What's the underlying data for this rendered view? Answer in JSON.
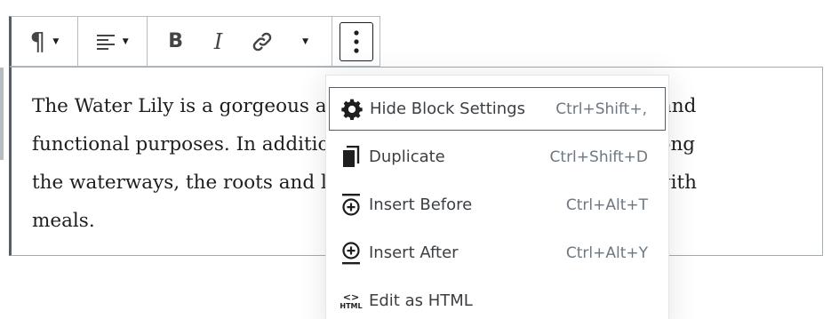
{
  "paragraph": {
    "text": "The Water Lily is a gorgeous and often used flower for aesthetic and\nfunctional purposes.  In addition to the flowers used as blooms along\nthe waterways, the roots and leaves are used in culinary dishes with\nmeals."
  },
  "toolbar": {
    "paragraph_icon": "¶",
    "bold_label": "B",
    "italic_label": "I"
  },
  "menu": {
    "items": [
      {
        "label": "Hide Block Settings",
        "shortcut": "Ctrl+Shift+,",
        "icon": "gear-icon",
        "focused": true
      },
      {
        "label": "Duplicate",
        "shortcut": "Ctrl+Shift+D",
        "icon": "duplicate-icon",
        "focused": false
      },
      {
        "label": "Insert Before",
        "shortcut": "Ctrl+Alt+T",
        "icon": "insert-before-icon",
        "focused": false
      },
      {
        "label": "Insert After",
        "shortcut": "Ctrl+Alt+Y",
        "icon": "insert-after-icon",
        "focused": false
      },
      {
        "label": "Edit as HTML",
        "shortcut": "",
        "icon": "html-icon",
        "focused": false
      }
    ]
  },
  "colors": {
    "text": "#1e1e1e",
    "border": "#b5bcc2",
    "accent_border": "#555d66"
  }
}
